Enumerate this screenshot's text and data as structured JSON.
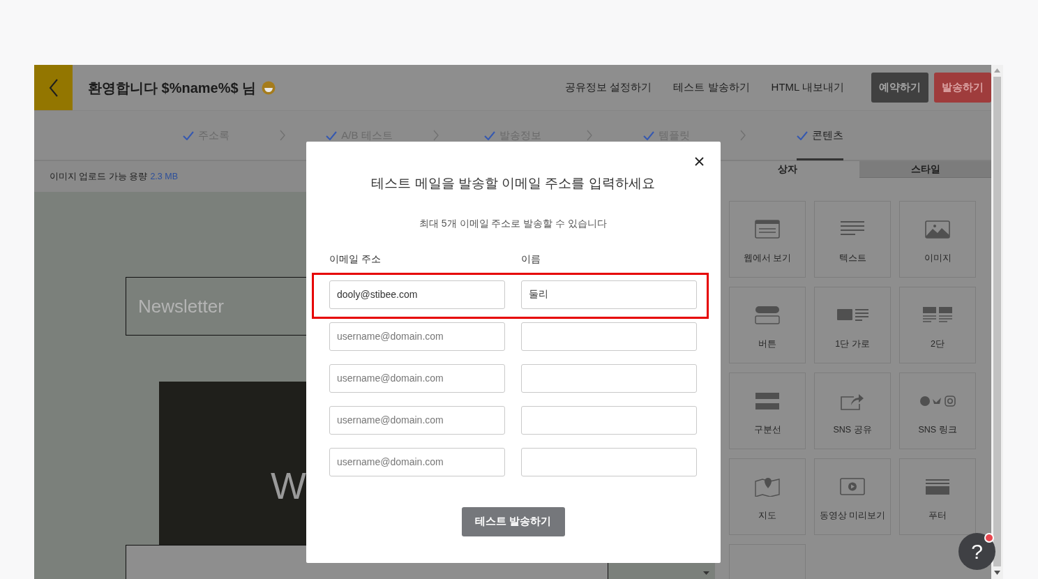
{
  "header": {
    "title": "환영합니다 $%name%$ 님",
    "links": [
      "공유정보 설정하기",
      "테스트 발송하기",
      "HTML 내보내기"
    ],
    "buttons": [
      {
        "label": "예약하기",
        "kind": "dark"
      },
      {
        "label": "발송하기",
        "kind": "danger"
      }
    ]
  },
  "steps": [
    {
      "label": "주소록",
      "done": true,
      "selected": false
    },
    {
      "label": "A/B 테스트",
      "done": true,
      "selected": false
    },
    {
      "label": "발송정보",
      "done": true,
      "selected": false
    },
    {
      "label": "템플릿",
      "done": true,
      "selected": false
    },
    {
      "label": "콘텐츠",
      "done": true,
      "selected": true
    }
  ],
  "upload_info": {
    "label": "이미지 업로드 가능 용량",
    "value": "2.3 MB"
  },
  "panel_tabs": [
    {
      "label": "상자",
      "selected": true
    },
    {
      "label": "스타일",
      "selected": false
    }
  ],
  "blocks": [
    {
      "kind": "block",
      "label": "웹에서 보기"
    },
    {
      "kind": "block",
      "label": "텍스트"
    },
    {
      "kind": "block",
      "label": "이미지"
    },
    {
      "kind": "block",
      "label": "버튼"
    },
    {
      "kind": "block",
      "label": "1단 가로"
    },
    {
      "kind": "block",
      "label": "2단"
    },
    {
      "kind": "block",
      "label": "구분선"
    },
    {
      "kind": "block",
      "label": "SNS 공유"
    },
    {
      "kind": "block",
      "label": "SNS 링크"
    },
    {
      "kind": "block",
      "label": "지도"
    },
    {
      "kind": "block",
      "label": "동영상 미리보기"
    },
    {
      "kind": "block",
      "label": "푸터"
    },
    {
      "kind": "empty"
    }
  ],
  "canvas": {
    "heading": "Newsletter",
    "banner_text": "W"
  },
  "dialog": {
    "title": "테스트 메일을 발송할 이메일 주소를 입력하세요",
    "subtitle": "최대 5개 이메일 주소로 발송할 수 있습니다",
    "columns": [
      "이메일 주소",
      "이름"
    ],
    "rows": [
      {
        "email": "dooly@stibee.com",
        "name": "둘리",
        "highlighted": true
      },
      {
        "email_placeholder": "username@domain.com",
        "highlighted": false
      },
      {
        "email_placeholder": "username@domain.com",
        "highlighted": false
      },
      {
        "email_placeholder": "username@domain.com",
        "highlighted": false
      },
      {
        "email_placeholder": "username@domain.com",
        "highlighted": false
      }
    ],
    "submit": "테스트 발송하기"
  },
  "help": {
    "label": "?",
    "notification": true
  }
}
